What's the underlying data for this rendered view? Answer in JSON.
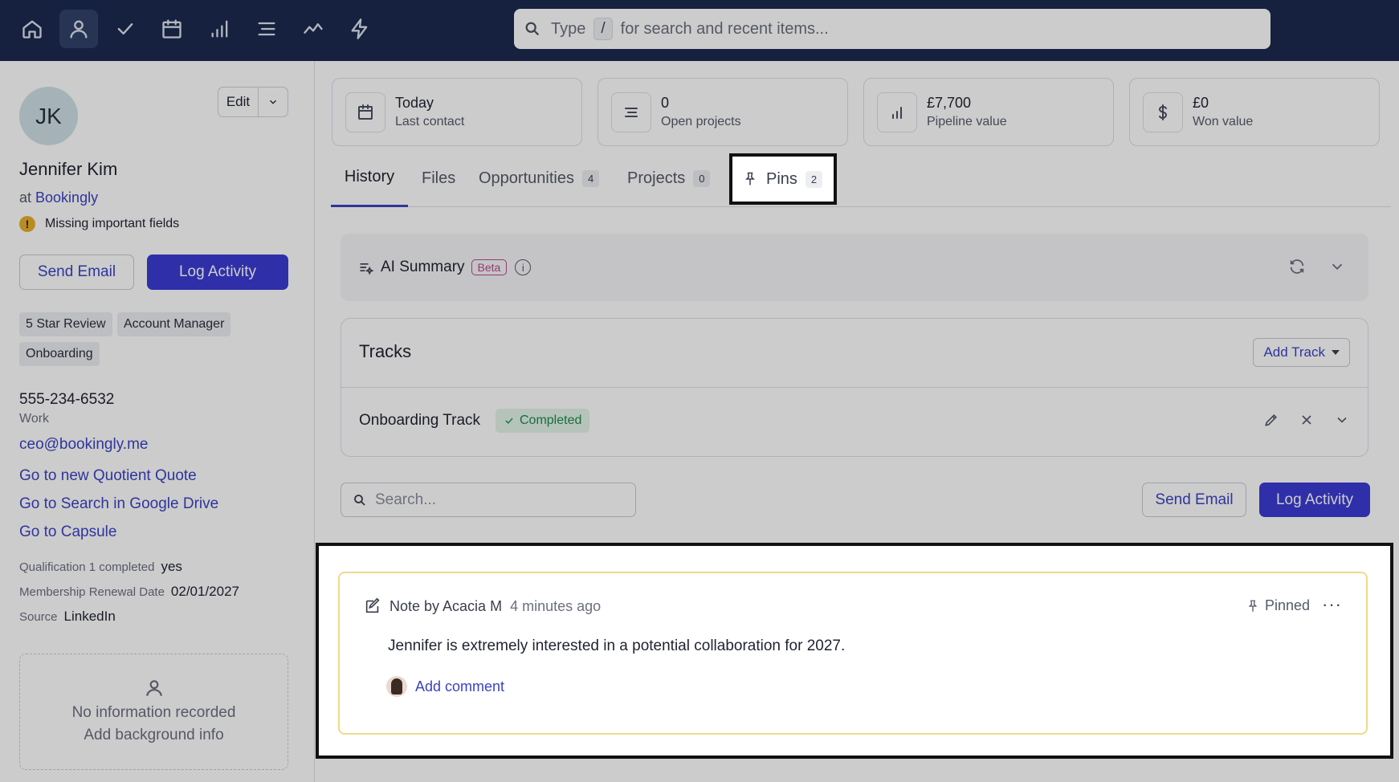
{
  "topbar": {
    "nav": [
      {
        "name": "home-icon"
      },
      {
        "name": "contacts-icon"
      },
      {
        "name": "tasks-check-icon"
      },
      {
        "name": "calendar-icon"
      },
      {
        "name": "pipeline-bars-icon"
      },
      {
        "name": "projects-list-icon"
      },
      {
        "name": "reports-line-icon"
      },
      {
        "name": "workflows-bolt-icon"
      }
    ],
    "search": {
      "prefix": "Type",
      "key": "/",
      "suffix": "for search and recent items..."
    }
  },
  "contact": {
    "initials": "JK",
    "name": "Jennifer Kim",
    "at_label": "at",
    "company": "Bookingly",
    "warning": "Missing important fields",
    "edit_label": "Edit",
    "send_email": "Send Email",
    "log_activity": "Log Activity",
    "tags": [
      "5 Star Review",
      "Account Manager",
      "Onboarding"
    ],
    "phone": "555-234-6532",
    "phone_type": "Work",
    "email": "ceo@bookingly.me",
    "links": [
      "Go to new Quotient Quote",
      "Go to Search in Google Drive",
      "Go to Capsule"
    ],
    "fields": [
      {
        "label": "Qualification 1 completed",
        "value": "yes"
      },
      {
        "label": "Membership Renewal Date",
        "value": "02/01/2027"
      },
      {
        "label": "Source",
        "value": "LinkedIn"
      }
    ],
    "background": {
      "line1": "No information recorded",
      "line2": "Add background info"
    }
  },
  "stats": [
    {
      "value": "Today",
      "label": "Last contact",
      "icon": "calendar-icon"
    },
    {
      "value": "0",
      "label": "Open projects",
      "icon": "projects-list-icon"
    },
    {
      "value": "£7,700",
      "label": "Pipeline value",
      "icon": "bar-chart-icon"
    },
    {
      "value": "£0",
      "label": "Won value",
      "icon": "dollar-icon"
    }
  ],
  "tabs": {
    "history": "History",
    "files": "Files",
    "opportunities": "Opportunities",
    "opportunities_count": "4",
    "projects": "Projects",
    "projects_count": "0",
    "pins": "Pins",
    "pins_count": "2"
  },
  "ai_summary": {
    "title": "AI Summary",
    "badge": "Beta"
  },
  "tracks": {
    "title": "Tracks",
    "add": "Add Track",
    "track_name": "Onboarding Track",
    "status": "Completed"
  },
  "history": {
    "search_placeholder": "Search...",
    "send_email": "Send Email",
    "log_activity": "Log Activity"
  },
  "note": {
    "author": "Note by Acacia M",
    "time": "4 minutes ago",
    "pinned": "Pinned",
    "more": "···",
    "body": "Jennifer is extremely interested in a potential collaboration for 2027.",
    "add_comment": "Add comment"
  },
  "colors": {
    "topbar": "#1b2a4e",
    "accent": "#3b43c4",
    "primary_button": "#3b3bd4",
    "note_border": "#f0d98a"
  }
}
